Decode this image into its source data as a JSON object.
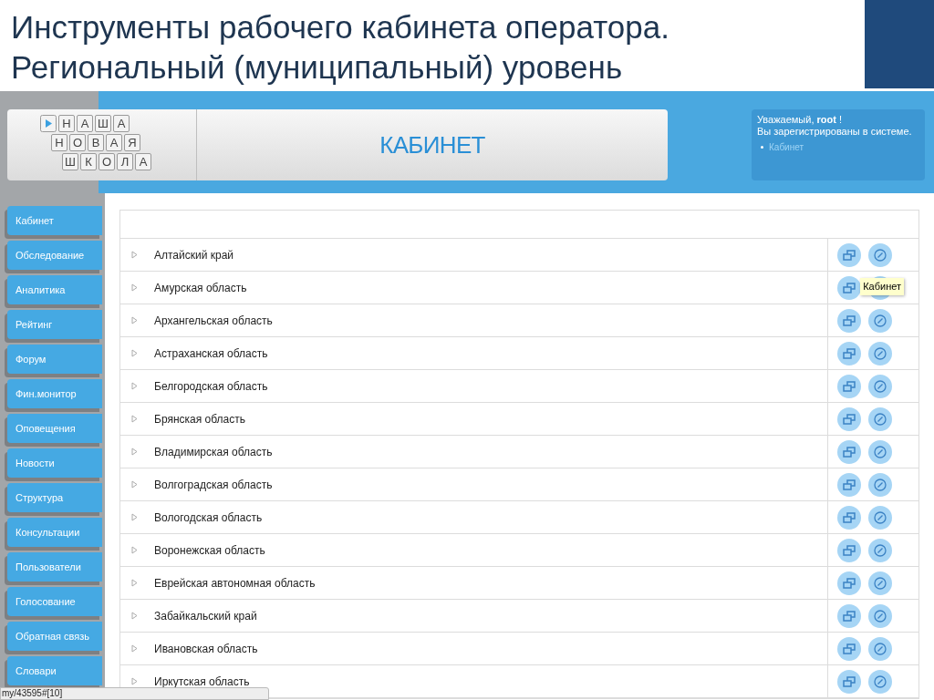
{
  "slide_title": [
    "Инструменты рабочего кабинета оператора.",
    "Региональный (муниципальный) уровень"
  ],
  "logo": {
    "rows": [
      [
        "Н",
        "А",
        "Ш",
        "А"
      ],
      [
        "Н",
        "О",
        "В",
        "А",
        "Я"
      ],
      [
        "Ш",
        "К",
        "О",
        "Л",
        "А"
      ]
    ]
  },
  "header_title": "КАБИНЕТ",
  "welcome": {
    "greeting": "Уважаемый, **root** !",
    "message": "Вы зарегистрированы в системе.",
    "links": [
      "Кабинет"
    ]
  },
  "sidebar": {
    "items": [
      "Кабинет",
      "Обследование",
      "Аналитика",
      "Рейтинг",
      "Форум",
      "Фин.монитор",
      "Оповещения",
      "Новости",
      "Структура",
      "Консультации",
      "Пользователи",
      "Голосование",
      "Обратная связь",
      "Словари"
    ]
  },
  "table": {
    "rows": [
      {
        "name": "Алтайский край"
      },
      {
        "name": "Амурская область",
        "tooltip": "Кабинет"
      },
      {
        "name": "Архангельская область"
      },
      {
        "name": "Астраханская область"
      },
      {
        "name": "Белгородская область"
      },
      {
        "name": "Брянская область"
      },
      {
        "name": "Владимирская область"
      },
      {
        "name": "Волгоградская область"
      },
      {
        "name": "Вологодская область"
      },
      {
        "name": "Воронежская область"
      },
      {
        "name": "Еврейская автономная область"
      },
      {
        "name": "Забайкальский край"
      },
      {
        "name": "Ивановская область"
      },
      {
        "name": "Иркутская область"
      }
    ]
  },
  "status_bar": "my/43595#[10]"
}
